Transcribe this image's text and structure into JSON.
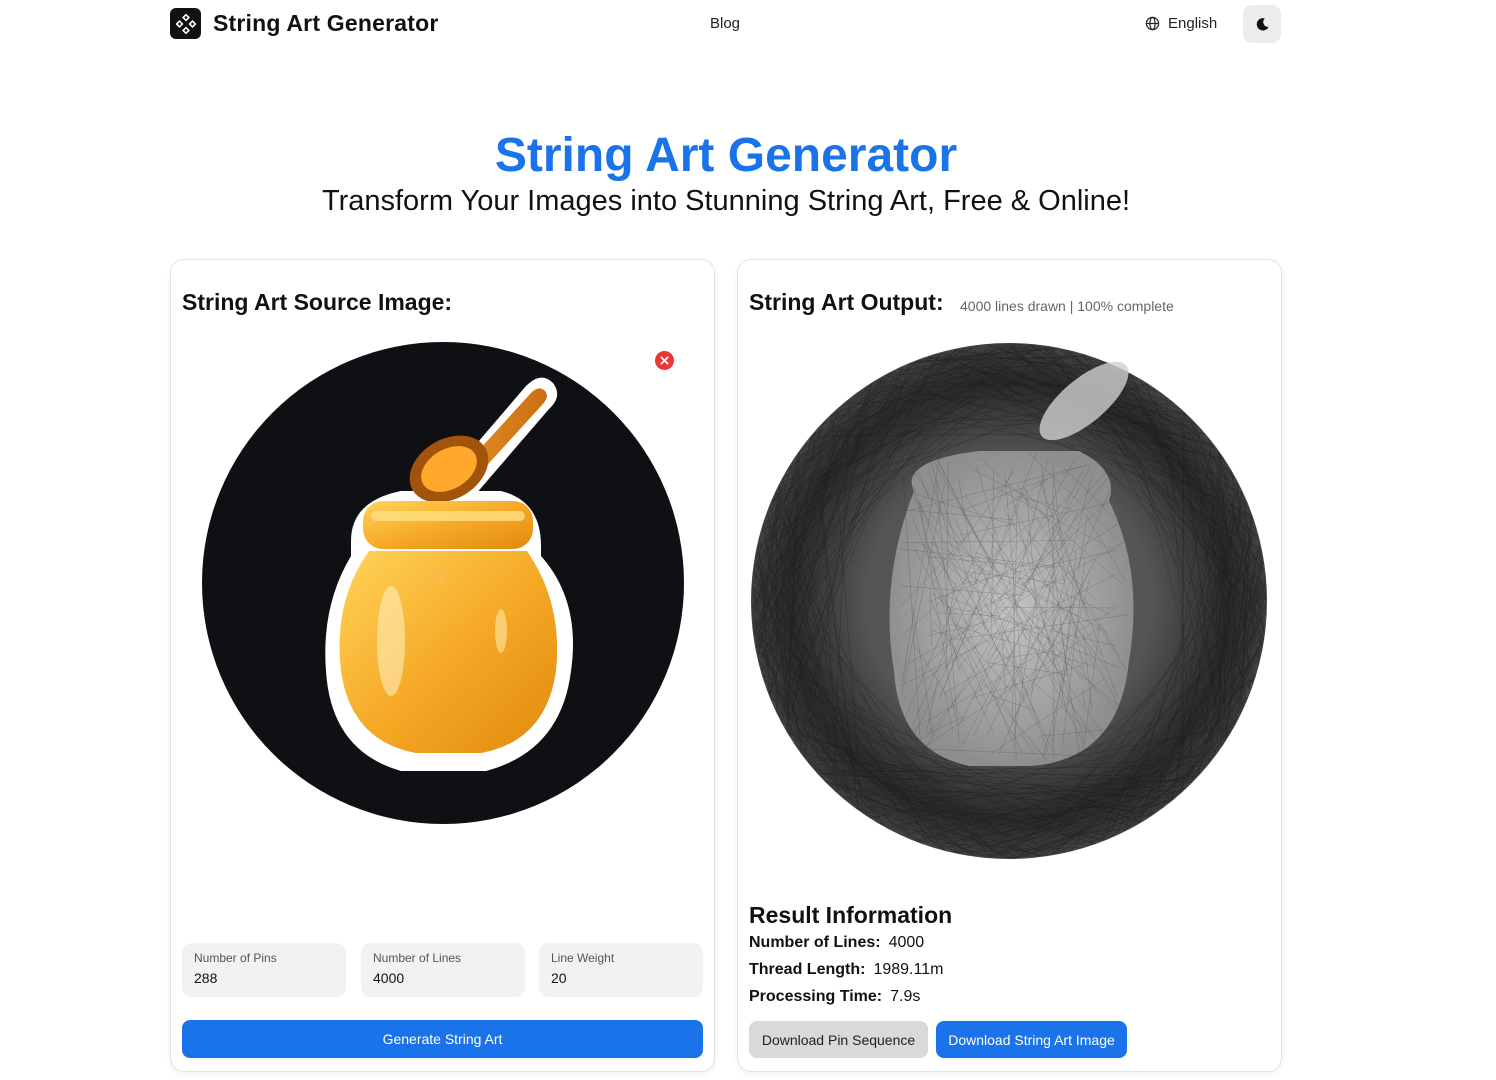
{
  "header": {
    "brand_title": "String Art Generator",
    "nav_blog": "Blog",
    "language": "English",
    "logo_icon": "diamond-grid-icon",
    "globe_icon": "globe-icon",
    "theme_icon": "moon-icon"
  },
  "hero": {
    "title": "String Art Generator",
    "subtitle": "Transform Your Images into Stunning String Art, Free & Online!"
  },
  "source_panel": {
    "heading": "String Art Source Image:",
    "remove_icon": "close-circle-icon",
    "params": [
      {
        "label": "Number of Pins",
        "value": "288"
      },
      {
        "label": "Number of Lines",
        "value": "4000"
      },
      {
        "label": "Line Weight",
        "value": "20"
      }
    ],
    "generate_label": "Generate String Art"
  },
  "output_panel": {
    "heading": "String Art Output:",
    "status": "4000 lines drawn | 100% complete",
    "result_heading": "Result Information",
    "results": [
      {
        "label": "Number of Lines:",
        "value": "4000"
      },
      {
        "label": "Thread Length:",
        "value": "1989.11m"
      },
      {
        "label": "Processing Time:",
        "value": "7.9s"
      }
    ],
    "download_pins_label": "Download Pin Sequence",
    "download_image_label": "Download String Art Image"
  },
  "colors": {
    "accent": "#1a73e8",
    "danger": "#e53935",
    "honey": "#f5a623"
  }
}
